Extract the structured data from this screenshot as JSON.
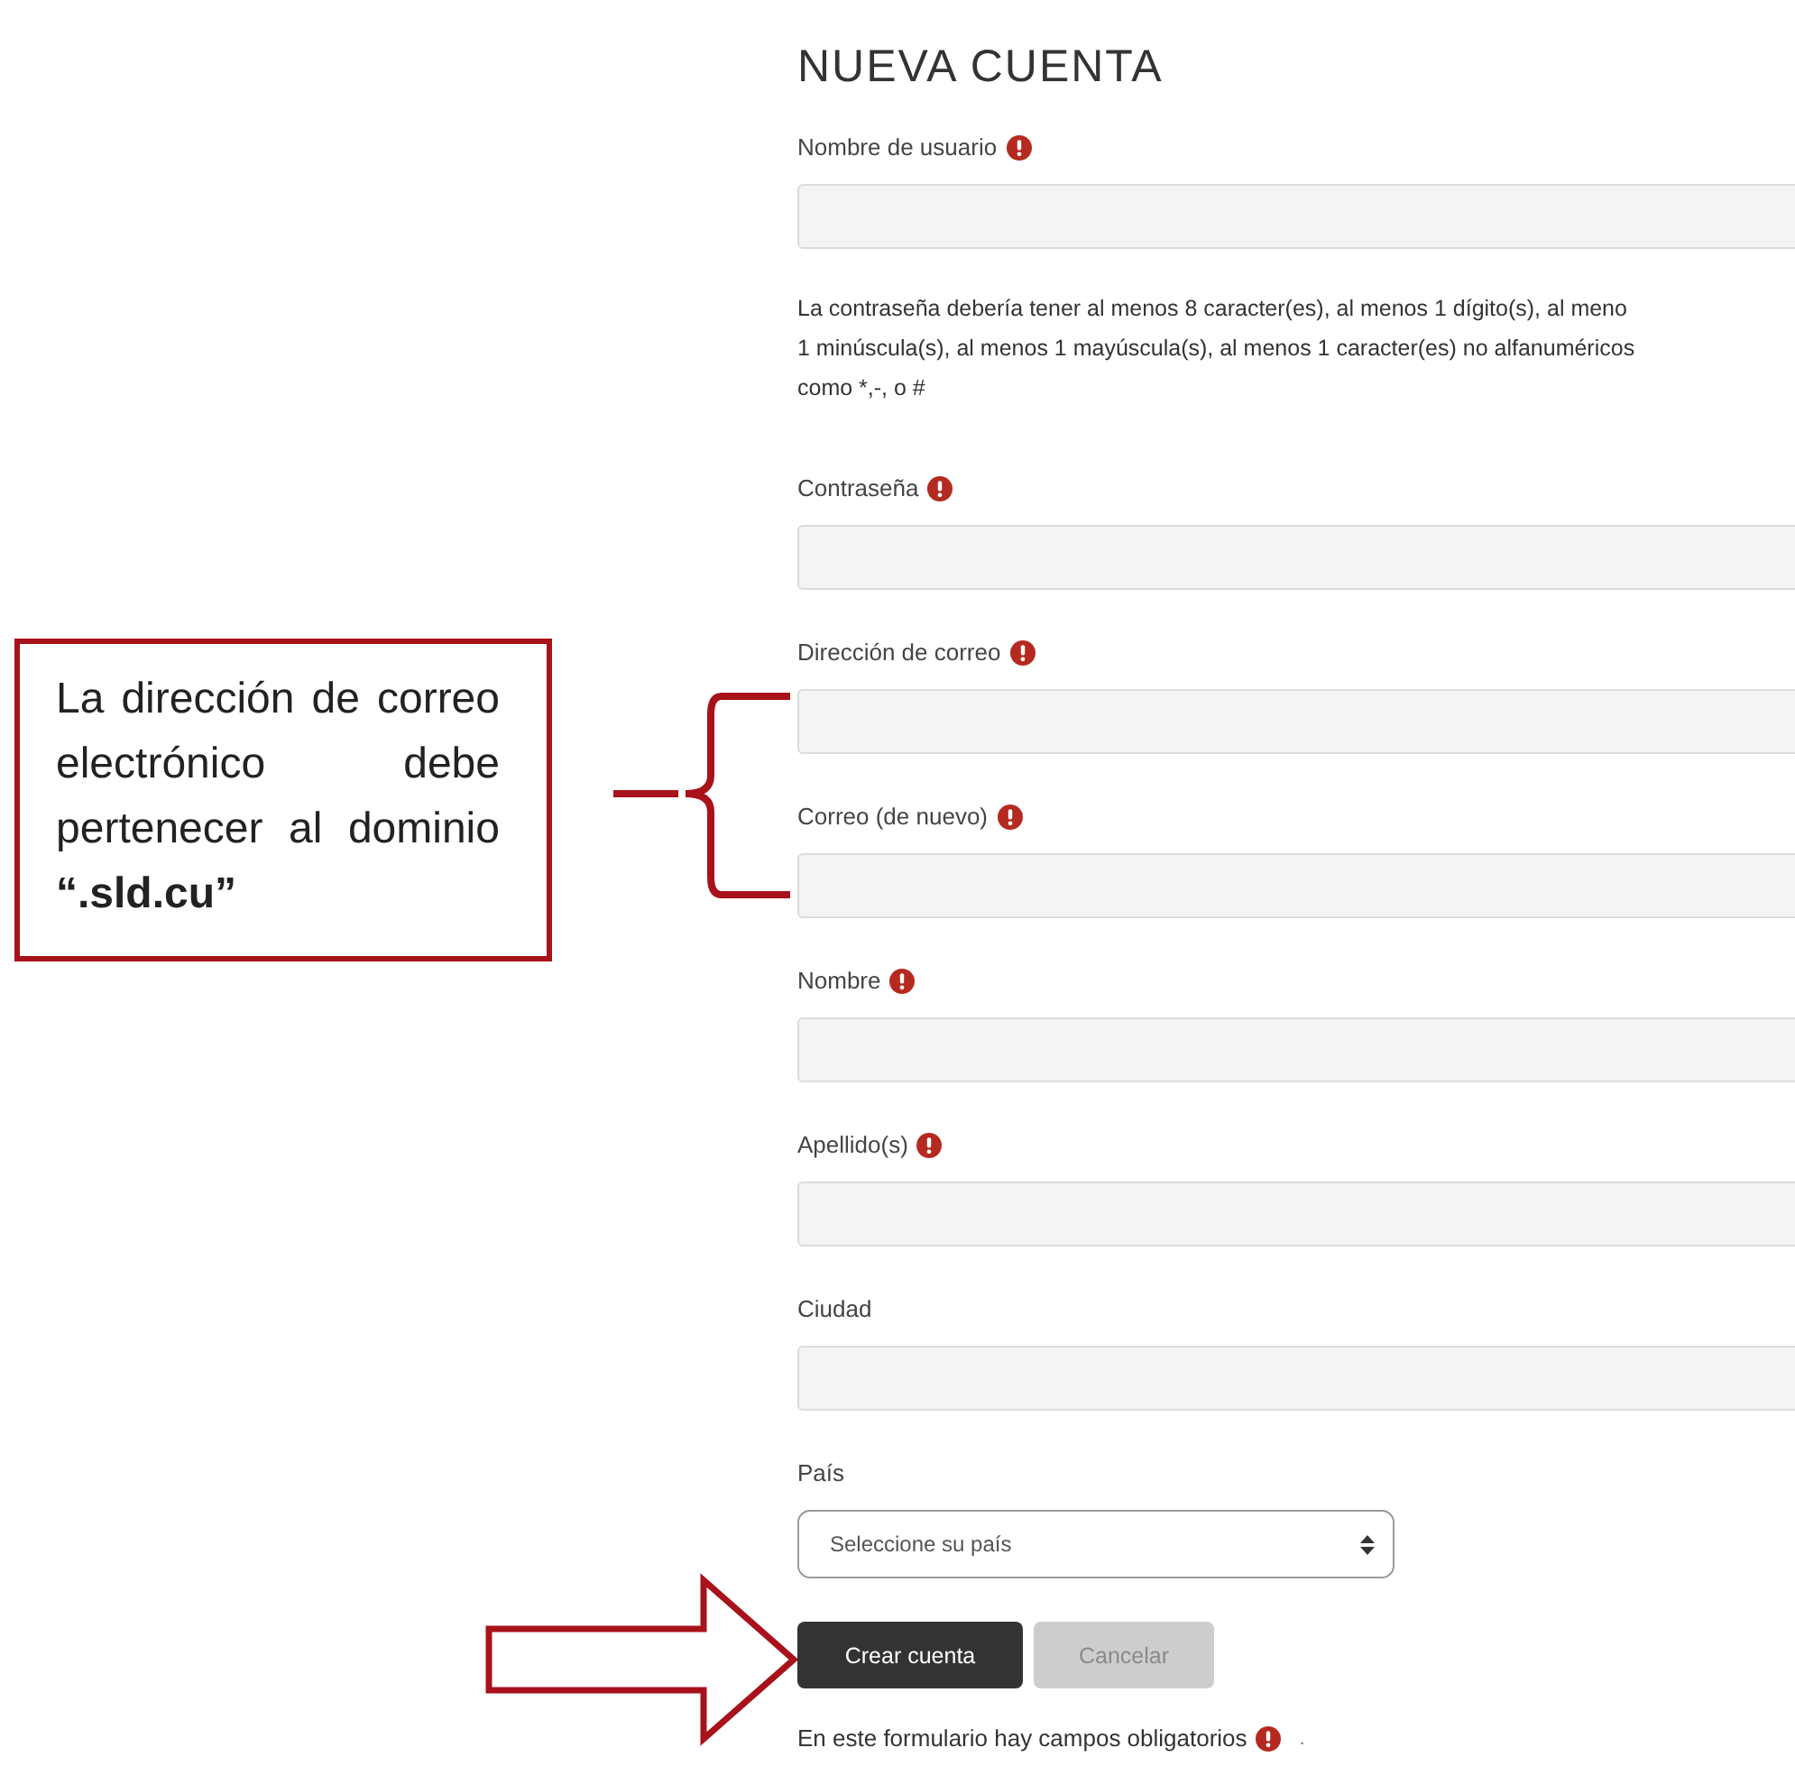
{
  "form": {
    "title": "NUEVA CUENTA",
    "items": [
      {
        "kind": "field",
        "label": "Nombre de usuario",
        "required": true
      },
      {
        "kind": "note",
        "lines": [
          "La contraseña debería tener al menos 8 caracter(es), al menos 1 dígito(s), al meno",
          "1 minúscula(s), al menos 1 mayúscula(s), al menos 1 caracter(es) no alfanuméricos",
          "como *,-, o #"
        ]
      },
      {
        "kind": "field",
        "label": "Contraseña",
        "required": true
      },
      {
        "kind": "field",
        "label": "Dirección de correo",
        "required": true
      },
      {
        "kind": "field",
        "label": "Correo (de nuevo)",
        "required": true
      },
      {
        "kind": "field",
        "label": "Nombre",
        "required": true
      },
      {
        "kind": "field",
        "label": "Apellido(s)",
        "required": true
      },
      {
        "kind": "field",
        "label": "Ciudad",
        "required": false
      },
      {
        "kind": "select",
        "label": "País",
        "value": "Seleccione su país",
        "required": false
      }
    ],
    "buttons": [
      {
        "label": "Crear cuenta",
        "kind": "primary"
      },
      {
        "label": "Cancelar",
        "kind": "secondary"
      }
    ],
    "footer": {
      "text": "En este formulario hay campos obligatorios",
      "required": true,
      "trailing": "."
    }
  },
  "annotation": {
    "text": "La dirección de correo electrónico debe pertenecer al dominio **“.sld.cu”**"
  }
}
